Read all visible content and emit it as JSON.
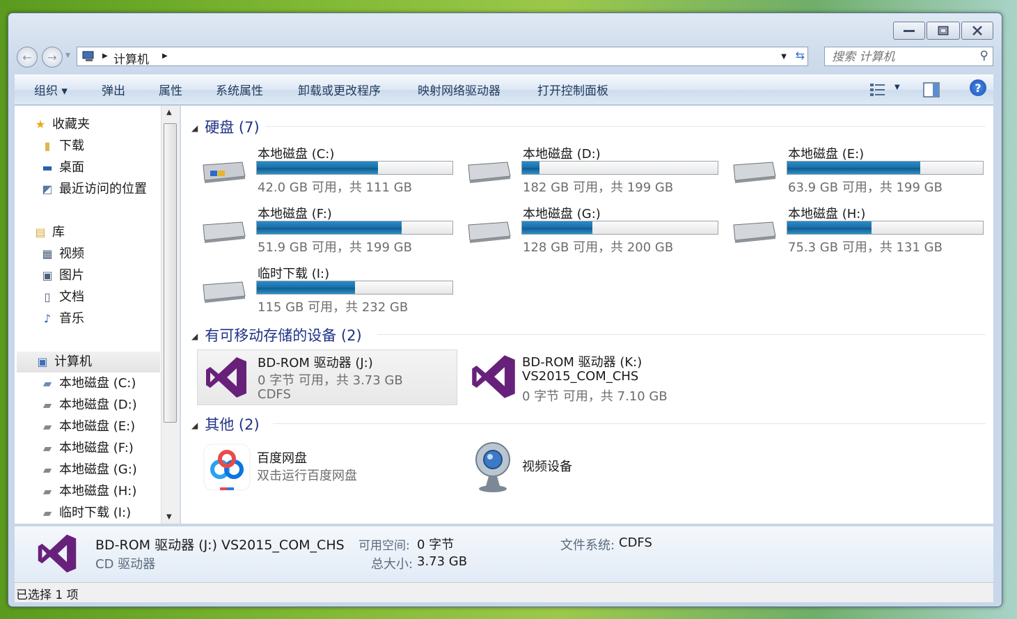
{
  "address": {
    "crumb": "计算机"
  },
  "search": {
    "placeholder": "搜索 计算机"
  },
  "toolbar": {
    "organize": "组织 ▾",
    "eject": "弹出",
    "properties": "属性",
    "system_properties": "系统属性",
    "uninstall": "卸载或更改程序",
    "map_drive": "映射网络驱动器",
    "control_panel": "打开控制面板"
  },
  "sidebar": {
    "favorites": "收藏夹",
    "downloads": "下载",
    "desktop": "桌面",
    "recent": "最近访问的位置",
    "libraries": "库",
    "videos": "视频",
    "pictures": "图片",
    "documents": "文档",
    "music": "音乐",
    "computer": "计算机",
    "drives": [
      "本地磁盘 (C:)",
      "本地磁盘 (D:)",
      "本地磁盘 (E:)",
      "本地磁盘 (F:)",
      "本地磁盘 (G:)",
      "本地磁盘 (H:)",
      "临时下载 (I:)"
    ]
  },
  "groups": {
    "hard_disks": "硬盘 (7)",
    "removable": "有可移动存储的设备 (2)",
    "other": "其他 (2)"
  },
  "drives": [
    {
      "name": "本地磁盘 (C:)",
      "info": "42.0 GB 可用，共 111 GB",
      "used_fraction": 0.62
    },
    {
      "name": "本地磁盘 (D:)",
      "info": "182 GB 可用，共 199 GB",
      "used_fraction": 0.09
    },
    {
      "name": "本地磁盘 (E:)",
      "info": "63.9 GB 可用，共 199 GB",
      "used_fraction": 0.68
    },
    {
      "name": "本地磁盘 (F:)",
      "info": "51.9 GB 可用，共 199 GB",
      "used_fraction": 0.74
    },
    {
      "name": "本地磁盘 (G:)",
      "info": "128 GB 可用，共 200 GB",
      "used_fraction": 0.36
    },
    {
      "name": "本地磁盘 (H:)",
      "info": "75.3 GB 可用，共 131 GB",
      "used_fraction": 0.43
    },
    {
      "name": "临时下载 (I:)",
      "info": "115 GB 可用，共 232 GB",
      "used_fraction": 0.5
    }
  ],
  "removable": [
    {
      "name": "BD-ROM 驱动器 (J:)",
      "line2": "0 字节 可用，共 3.73 GB",
      "line3": "CDFS"
    },
    {
      "name": "BD-ROM 驱动器 (K:)",
      "line2": "VS2015_COM_CHS",
      "line3": "0 字节 可用，共 7.10 GB"
    }
  ],
  "other": [
    {
      "name": "百度网盘",
      "desc": "双击运行百度网盘"
    },
    {
      "name": "视频设备"
    }
  ],
  "details": {
    "title": "BD-ROM 驱动器 (J:) VS2015_COM_CHS",
    "free_label": "可用空间:",
    "free_value": "0 字节",
    "type": "CD 驱动器",
    "size_label": "总大小:",
    "size_value": "3.73 GB",
    "fs_label": "文件系统:",
    "fs_value": "CDFS"
  },
  "status": "已选择 1 项",
  "colors": {
    "accent": "#1e3287",
    "bar": "#1b6ea8",
    "vs_purple": "#68217a"
  }
}
